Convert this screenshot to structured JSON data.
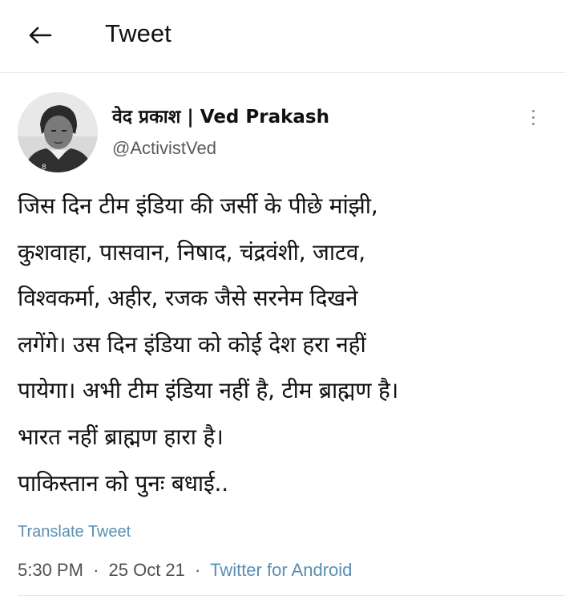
{
  "header": {
    "title": "Tweet",
    "back_icon": "arrow-left-icon"
  },
  "author": {
    "name": "वेद प्रकाश | Ved Prakash",
    "handle": "@ActivistVed",
    "avatar_icon": "profile-photo"
  },
  "tweet": {
    "lines": [
      "जिस दिन टीम इंडिया की जर्सी के पीछे मांझी,",
      "कुशवाहा, पासवान, निषाद, चंद्रवंशी, जाटव,",
      "विश्वकर्मा, अहीर, रजक जैसे सरनेम दिखने",
      "लगेंगे। उस दिन इंडिया को कोई देश हरा नहीं",
      "पायेगा। अभी टीम इंडिया नहीं है, टीम ब्राह्मण है।",
      "भारत नहीं ब्राह्मण हारा है।",
      "पाकिस्तान को पुनः बधाई.."
    ],
    "translate_label": "Translate Tweet",
    "time": "5:30 PM",
    "separator": "·",
    "date": "25 Oct 21",
    "source": "Twitter for Android"
  },
  "colors": {
    "link": "#5b8fb3",
    "secondary_text": "#5a5a5a"
  }
}
